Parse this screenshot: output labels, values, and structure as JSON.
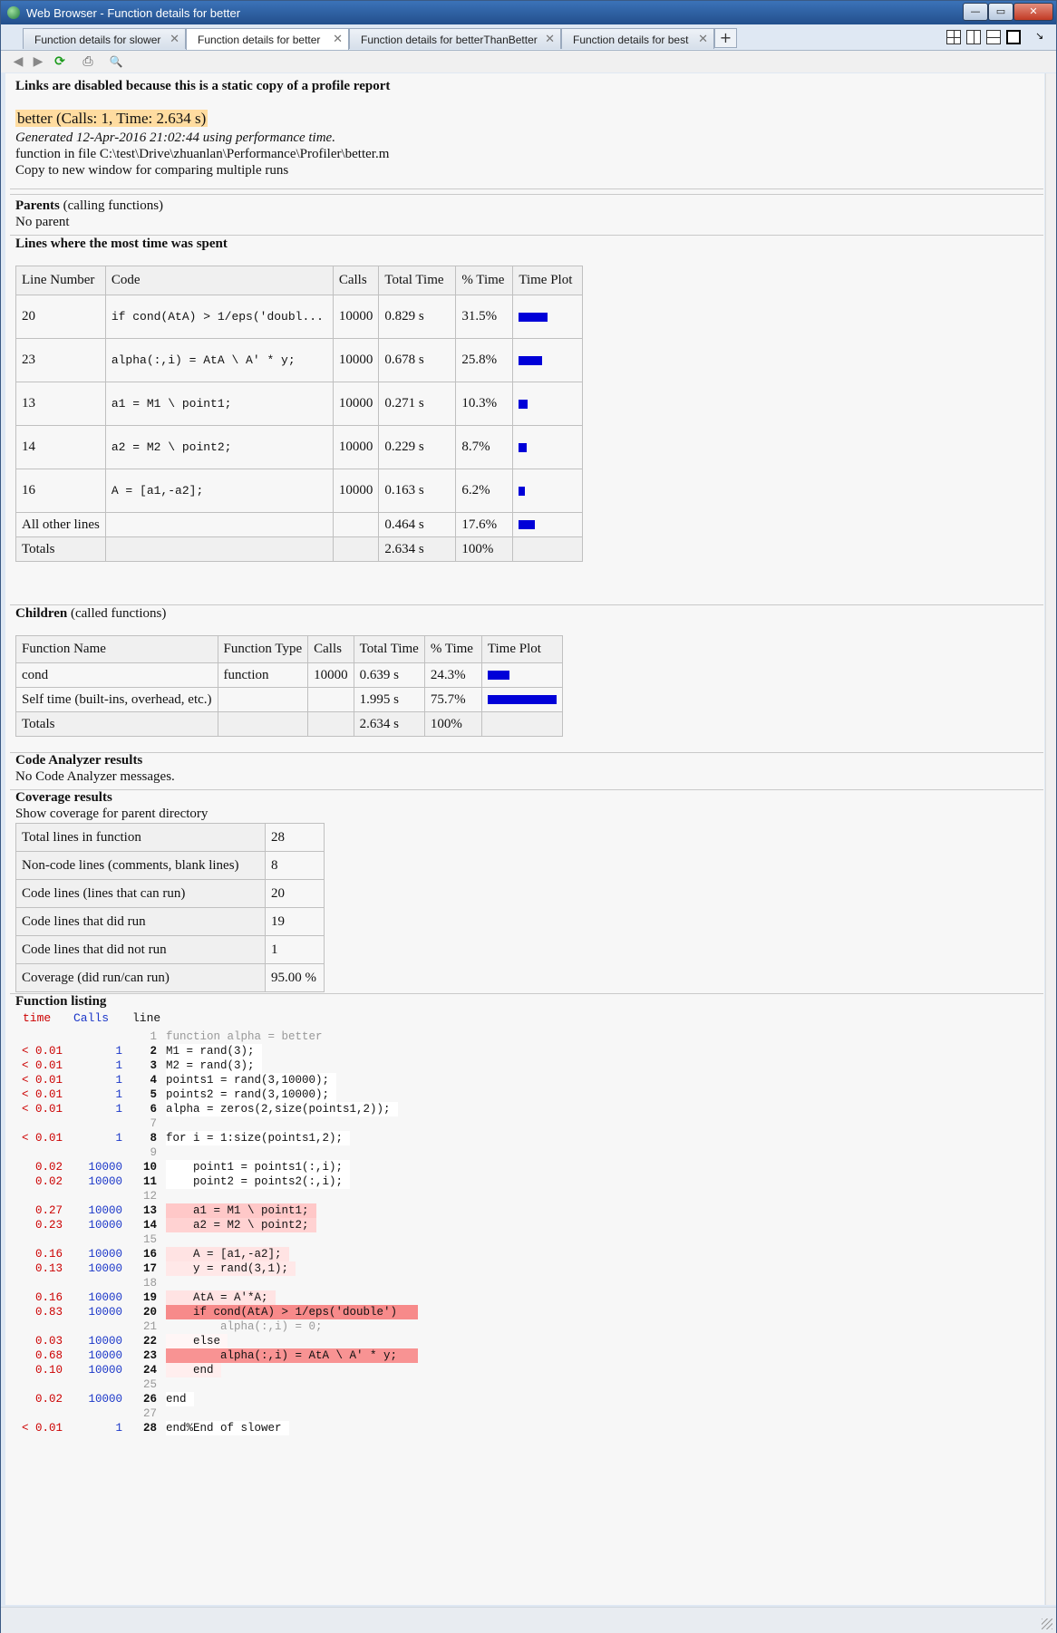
{
  "window": {
    "title": "Web Browser - Function details for better",
    "buttons": {
      "minimize": "—",
      "maximize": "▭",
      "close": "✕"
    }
  },
  "tabs": [
    {
      "label": "Function details for slower",
      "active": false
    },
    {
      "label": "Function details for better",
      "active": true
    },
    {
      "label": "Function details for betterThanBetter",
      "active": false
    },
    {
      "label": "Function details for best",
      "active": false
    }
  ],
  "tab_close": "✕",
  "tab_add": "+",
  "toolbar": {
    "back": "◀",
    "forward": "▶",
    "refresh": "⟳",
    "print": "⎙",
    "find": "🔍"
  },
  "report": {
    "notice": "Links are disabled because this is a static copy of a profile report",
    "heading": "better (Calls: 1, Time: 2.634 s)",
    "generated": "Generated 12-Apr-2016 21:02:44 using performance time.",
    "file": "function in file C:\\test\\Drive\\zhuanlan\\Performance\\Profiler\\better.m",
    "copy": "Copy to new window for comparing multiple runs"
  },
  "parents": {
    "title": "Parents",
    "sub": " (calling functions)",
    "value": "No parent"
  },
  "lines_section": {
    "title": "Lines where the most time was spent",
    "headers": [
      "Line Number",
      "Code",
      "Calls",
      "Total Time",
      "% Time",
      "Time Plot"
    ],
    "rows": [
      {
        "line": "20",
        "code": "if cond(AtA) > 1/eps('doubl...",
        "calls": "10000",
        "time": "0.829 s",
        "pct": "31.5%",
        "frac": 0.315
      },
      {
        "line": "23",
        "code": "alpha(:,i) = AtA \\ A' * y;",
        "calls": "10000",
        "time": "0.678 s",
        "pct": "25.8%",
        "frac": 0.258
      },
      {
        "line": "13",
        "code": "a1 = M1 \\ point1;",
        "calls": "10000",
        "time": "0.271 s",
        "pct": "10.3%",
        "frac": 0.103
      },
      {
        "line": "14",
        "code": "a2 = M2 \\ point2;",
        "calls": "10000",
        "time": "0.229 s",
        "pct": "8.7%",
        "frac": 0.087
      },
      {
        "line": "16",
        "code": "A = [a1,-a2];",
        "calls": "10000",
        "time": "0.163 s",
        "pct": "6.2%",
        "frac": 0.062
      },
      {
        "line": "All other lines",
        "code": "",
        "calls": "",
        "time": "0.464 s",
        "pct": "17.6%",
        "frac": 0.176
      },
      {
        "line": "Totals",
        "code": "",
        "calls": "",
        "time": "2.634 s",
        "pct": "100%",
        "frac": 0
      }
    ]
  },
  "children": {
    "title": "Children",
    "sub": " (called functions)",
    "headers": [
      "Function Name",
      "Function Type",
      "Calls",
      "Total Time",
      "% Time",
      "Time Plot"
    ],
    "rows": [
      {
        "name": "cond",
        "type": "function",
        "calls": "10000",
        "time": "0.639 s",
        "pct": "24.3%",
        "frac": 0.243
      },
      {
        "name": "Self time (built-ins, overhead, etc.)",
        "type": "",
        "calls": "",
        "time": "1.995 s",
        "pct": "75.7%",
        "frac": 0.757
      },
      {
        "name": "Totals",
        "type": "",
        "calls": "",
        "time": "2.634 s",
        "pct": "100%",
        "frac": 0
      }
    ]
  },
  "analyzer": {
    "title": "Code Analyzer results",
    "value": "No Code Analyzer messages."
  },
  "coverage": {
    "title": "Coverage results",
    "link": "Show coverage for parent directory",
    "rows": [
      {
        "label": "Total lines in function",
        "value": "28"
      },
      {
        "label": "Non-code lines (comments, blank lines)",
        "value": "8"
      },
      {
        "label": "Code lines (lines that can run)",
        "value": "20"
      },
      {
        "label": "Code lines that did run",
        "value": "19"
      },
      {
        "label": "Code lines that did not run",
        "value": "1"
      },
      {
        "label": "Coverage (did run/can run)",
        "value": "95.00 %"
      }
    ]
  },
  "listing": {
    "title": "Function listing",
    "col_time": "time",
    "col_calls": "Calls",
    "col_line": "line",
    "lines": [
      {
        "t": "",
        "c": "",
        "n": "1",
        "code": "function alpha = better",
        "bg": "none",
        "dim": true
      },
      {
        "t": "< 0.01",
        "c": "1",
        "n": "2",
        "code": "M1 = rand(3);",
        "bg": "#ffffff",
        "dim": false
      },
      {
        "t": "< 0.01",
        "c": "1",
        "n": "3",
        "code": "M2 = rand(3);",
        "bg": "#ffffff",
        "dim": false
      },
      {
        "t": "< 0.01",
        "c": "1",
        "n": "4",
        "code": "points1 = rand(3,10000);",
        "bg": "#ffffff",
        "dim": false
      },
      {
        "t": "< 0.01",
        "c": "1",
        "n": "5",
        "code": "points2 = rand(3,10000);",
        "bg": "#ffffff",
        "dim": false
      },
      {
        "t": "< 0.01",
        "c": "1",
        "n": "6",
        "code": "alpha = zeros(2,size(points1,2));",
        "bg": "#ffffff",
        "dim": false
      },
      {
        "t": "",
        "c": "",
        "n": "7",
        "code": "",
        "bg": "none",
        "dim": true
      },
      {
        "t": "< 0.01",
        "c": "1",
        "n": "8",
        "code": "for i = 1:size(points1,2);",
        "bg": "#ffffff",
        "dim": false
      },
      {
        "t": "",
        "c": "",
        "n": "9",
        "code": "",
        "bg": "none",
        "dim": true
      },
      {
        "t": "0.02",
        "c": "10000",
        "n": "10",
        "code": "    point1 = points1(:,i);",
        "bg": "#ffffff",
        "dim": false
      },
      {
        "t": "0.02",
        "c": "10000",
        "n": "11",
        "code": "    point2 = points2(:,i);",
        "bg": "#ffffff",
        "dim": false
      },
      {
        "t": "",
        "c": "",
        "n": "12",
        "code": "",
        "bg": "none",
        "dim": true
      },
      {
        "t": "0.27",
        "c": "10000",
        "n": "13",
        "code": "    a1 = M1 \\ point1;",
        "bg": "#ffc8c8",
        "dim": false
      },
      {
        "t": "0.23",
        "c": "10000",
        "n": "14",
        "code": "    a2 = M2 \\ point2;",
        "bg": "#ffd2d2",
        "dim": false
      },
      {
        "t": "",
        "c": "",
        "n": "15",
        "code": "",
        "bg": "none",
        "dim": true
      },
      {
        "t": "0.16",
        "c": "10000",
        "n": "16",
        "code": "    A = [a1,-a2];",
        "bg": "#ffe3e3",
        "dim": false
      },
      {
        "t": "0.13",
        "c": "10000",
        "n": "17",
        "code": "    y = rand(3,1);",
        "bg": "#ffe8e8",
        "dim": false
      },
      {
        "t": "",
        "c": "",
        "n": "18",
        "code": "",
        "bg": "none",
        "dim": true
      },
      {
        "t": "0.16",
        "c": "10000",
        "n": "19",
        "code": "    AtA = A'*A;",
        "bg": "#ffe3e3",
        "dim": false
      },
      {
        "t": "0.83",
        "c": "10000",
        "n": "20",
        "code": "    if cond(AtA) > 1/eps('double')",
        "bg": "#f78a8a",
        "dim": false
      },
      {
        "t": "",
        "c": "",
        "n": "21",
        "code": "        alpha(:,i) = 0;",
        "bg": "none",
        "dim": true
      },
      {
        "t": "0.03",
        "c": "10000",
        "n": "22",
        "code": "    else",
        "bg": "#fff6f6",
        "dim": false
      },
      {
        "t": "0.68",
        "c": "10000",
        "n": "23",
        "code": "        alpha(:,i) = AtA \\ A' * y;",
        "bg": "#f89393",
        "dim": false
      },
      {
        "t": "0.10",
        "c": "10000",
        "n": "24",
        "code": "    end",
        "bg": "#ffeeee",
        "dim": false
      },
      {
        "t": "",
        "c": "",
        "n": "25",
        "code": "",
        "bg": "none",
        "dim": true
      },
      {
        "t": "0.02",
        "c": "10000",
        "n": "26",
        "code": "end",
        "bg": "#ffffff",
        "dim": false
      },
      {
        "t": "",
        "c": "",
        "n": "27",
        "code": "",
        "bg": "none",
        "dim": true
      },
      {
        "t": "< 0.01",
        "c": "1",
        "n": "28",
        "code": "end%End of slower",
        "bg": "#ffffff",
        "dim": false
      }
    ]
  }
}
